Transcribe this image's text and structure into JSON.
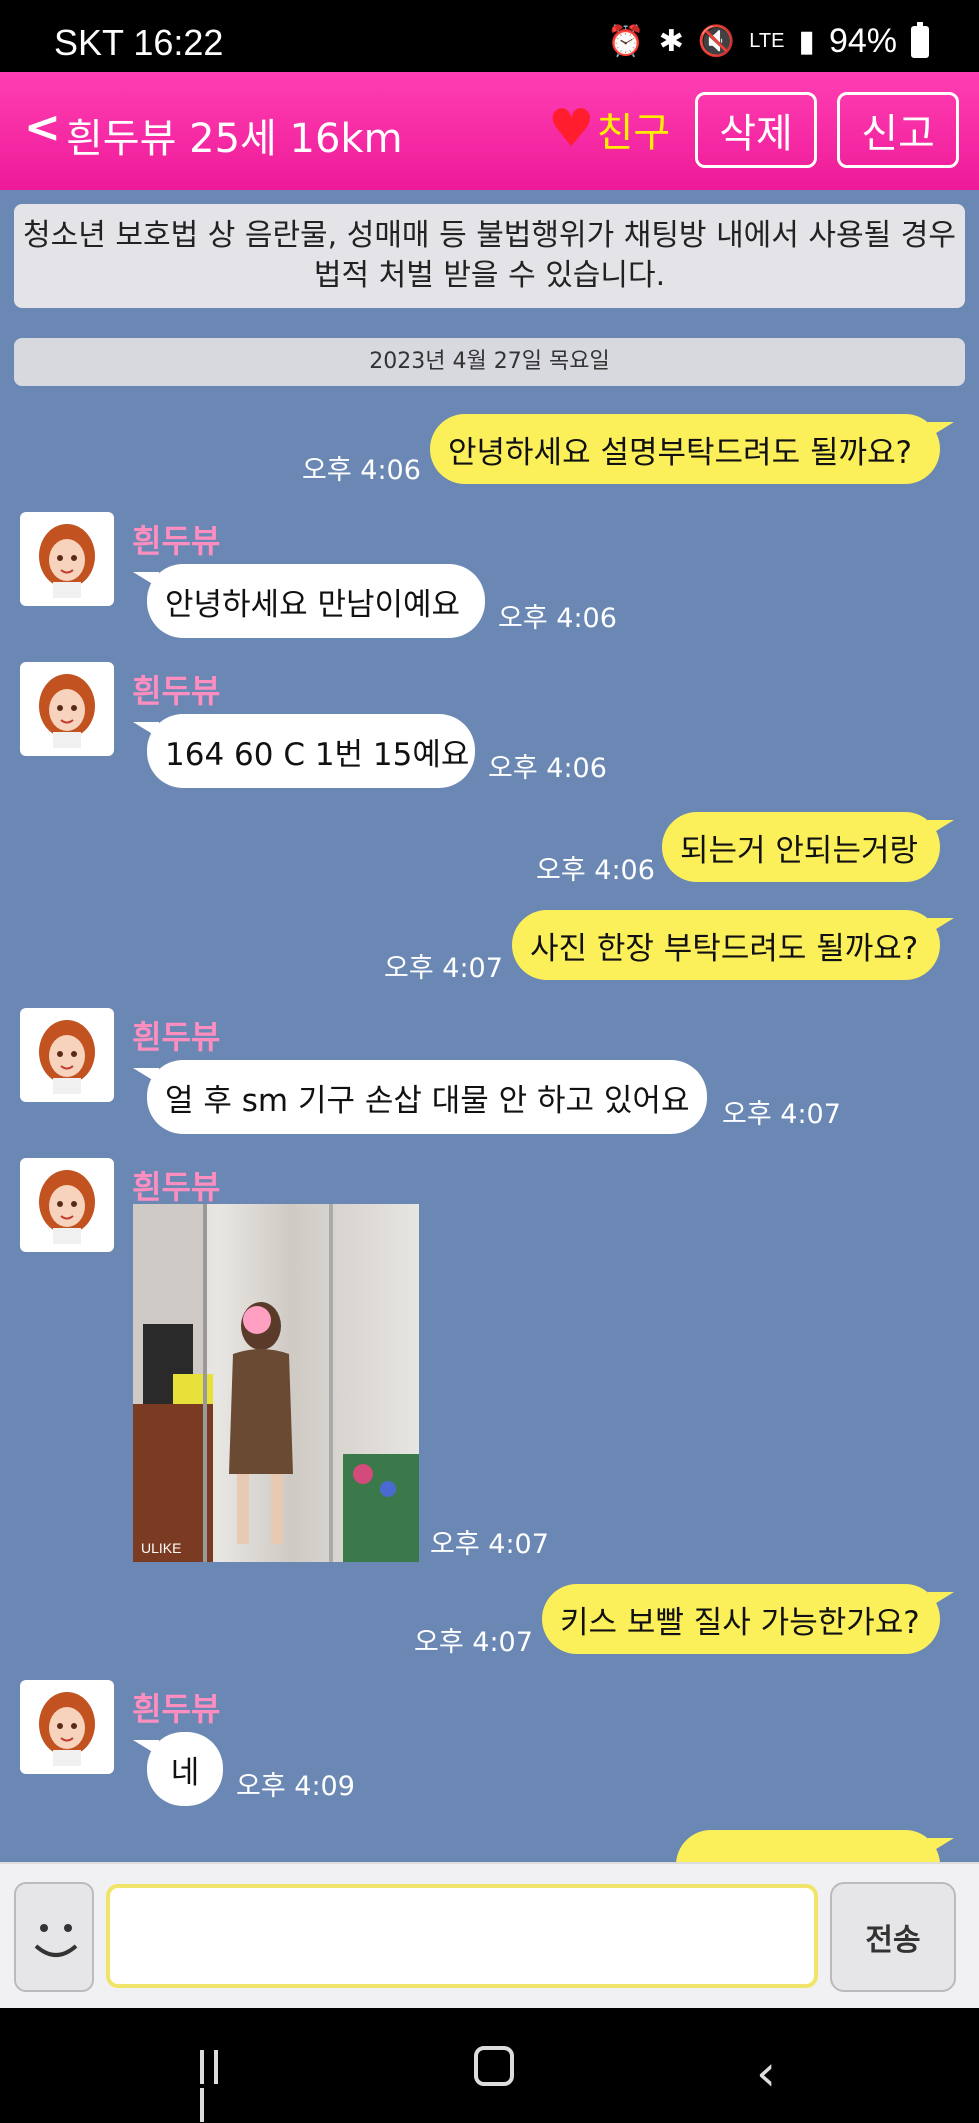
{
  "status_bar": {
    "carrier_time": "SKT 16:22",
    "network": "LTE",
    "battery": "94%"
  },
  "header": {
    "back": "<",
    "title": "흰두뷰 25세 16km",
    "friend_label": "친구",
    "delete_label": "삭제",
    "report_label": "신고"
  },
  "notice": "청소년 보호법 상 음란물, 성매매 등 불법행위가 채팅방 내에서 사용될 경우 법적 처벌 받을 수 있습니다.",
  "date_separator": "2023년 4월 27일 목요일",
  "messages": [
    {
      "sender": "me",
      "text": "안녕하세요 설명부탁드려도 될까요?",
      "time": "오후 4:06"
    },
    {
      "sender": "흰두뷰",
      "text": "안녕하세요 만남이예요",
      "time": "오후 4:06"
    },
    {
      "sender": "흰두뷰",
      "text": "164 60 C 1번 15예요",
      "time": "오후 4:06"
    },
    {
      "sender": "me",
      "text": "되는거 안되는거랑",
      "time": "오후 4:06"
    },
    {
      "sender": "me",
      "text": "사진 한장 부탁드려도 될까요?",
      "time": "오후 4:07"
    },
    {
      "sender": "흰두뷰",
      "text": "얼 후 sm 기구 손삽 대물 안 하고 있어요",
      "time": "오후 4:07"
    },
    {
      "sender": "흰두뷰",
      "type": "photo",
      "time": "오후 4:07",
      "photo_caption": "ULIKE"
    },
    {
      "sender": "me",
      "text": "키스 보빨 질사 가능한가요?",
      "time": "오후 4:07"
    },
    {
      "sender": "흰두뷰",
      "text": "네",
      "time": "오후 4:09"
    }
  ],
  "input": {
    "value": "",
    "placeholder": ""
  },
  "send_label": "전송",
  "colors": {
    "header": "#ee1a98",
    "chat_bg": "#6b88b4",
    "my_bubble": "#fbf05a",
    "their_bubble": "#ffffff",
    "sender_name": "#ff8ec0"
  }
}
